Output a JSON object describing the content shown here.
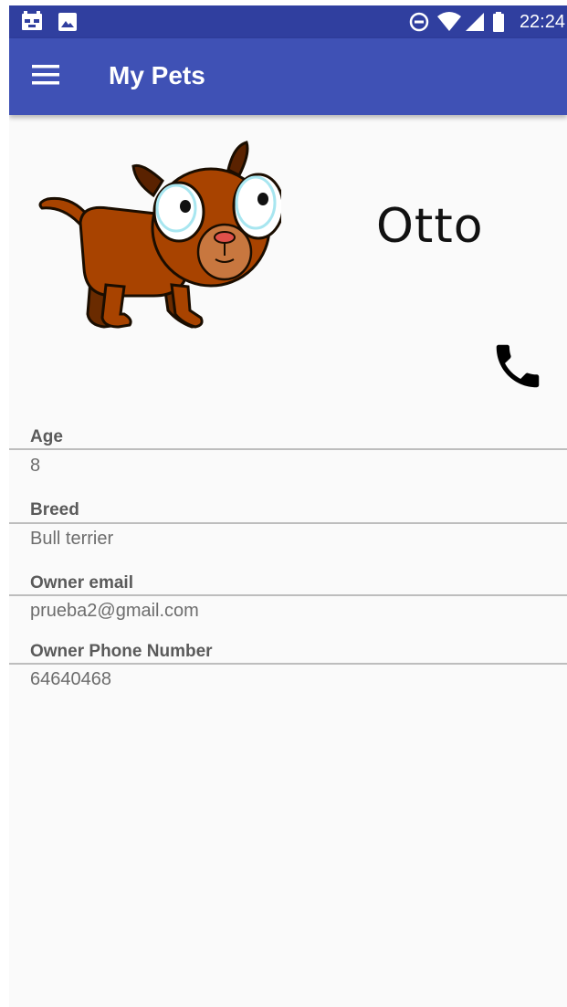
{
  "status_bar": {
    "time": "22:24",
    "left_icons": [
      "notification-app-icon",
      "image-icon"
    ],
    "right_icons": [
      "do-not-disturb-icon",
      "wifi-icon",
      "signal-icon",
      "battery-icon"
    ]
  },
  "app_bar": {
    "title": "My Pets",
    "menu_icon": "hamburger-menu-icon"
  },
  "pet": {
    "name": "Otto",
    "image": "cartoon-dog-illustration",
    "call_icon": "phone-icon"
  },
  "fields": [
    {
      "label": "Age",
      "value": "8"
    },
    {
      "label": "Breed",
      "value": "Bull terrier"
    },
    {
      "label": "Owner email",
      "value": "prueba2@gmail.com"
    },
    {
      "label": "Owner Phone Number",
      "value": "64640468"
    }
  ],
  "colors": {
    "status_bar": "#303f9f",
    "app_bar": "#3f51b5",
    "background": "#fafafa",
    "label_text": "#5a5a5a",
    "value_text": "#6d6d6d",
    "divider": "#bdbdbd"
  }
}
